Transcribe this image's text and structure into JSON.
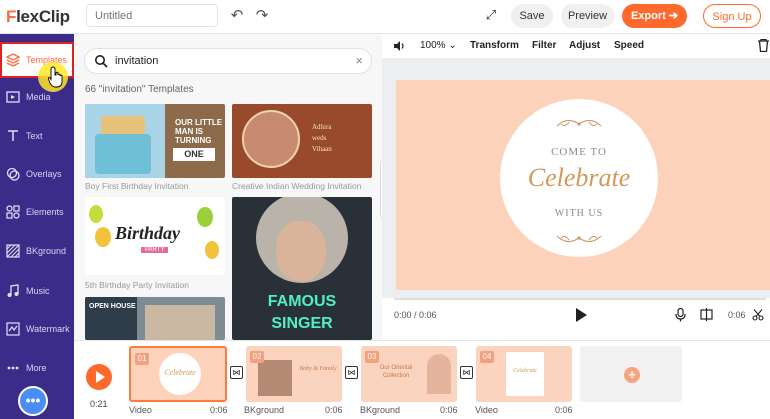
{
  "app": {
    "logo_f": "F",
    "logo_rest": "lexClip",
    "project_title_placeholder": "Untitled"
  },
  "topbar": {
    "save_label": "Save",
    "preview_label": "Preview",
    "export_label": "Export",
    "signup_label": "Sign Up"
  },
  "sidebar": {
    "items": [
      {
        "label": "Templates",
        "icon": "templates-icon"
      },
      {
        "label": "Media",
        "icon": "media-icon"
      },
      {
        "label": "Text",
        "icon": "text-icon"
      },
      {
        "label": "Overlays",
        "icon": "overlays-icon"
      },
      {
        "label": "Elements",
        "icon": "elements-icon"
      },
      {
        "label": "BKground",
        "icon": "background-icon"
      },
      {
        "label": "Music",
        "icon": "music-icon"
      },
      {
        "label": "Watermark",
        "icon": "watermark-icon"
      },
      {
        "label": "More",
        "icon": "more-icon"
      }
    ],
    "help_label": "•••"
  },
  "panel": {
    "search_value": "invitation",
    "result_count": "66 \"invitation\" Templates",
    "templates": [
      {
        "caption": "Boy First Birthday Invitation",
        "art_lines": [
          "OUR LITTLE",
          "MAN IS",
          "TURNING",
          "ONE"
        ]
      },
      {
        "caption": "Creative Indian Wedding Invitation",
        "art_lines": [
          "Adhira",
          "weds",
          "Vihaan"
        ]
      },
      {
        "caption": "5th Birthday Party Invitation",
        "art_lines": [
          "Birthday",
          "PARTY"
        ]
      },
      {
        "caption": "",
        "art_lines": [
          "FAMOUS",
          "SINGER"
        ]
      },
      {
        "caption": "",
        "art_lines": [
          "OPEN HOUSE"
        ]
      }
    ]
  },
  "toolbar": {
    "zoom": "100%",
    "transform": "Transform",
    "filter": "Filter",
    "adjust": "Adjust",
    "speed": "Speed"
  },
  "canvas": {
    "line1": "COME TO",
    "line2": "Celebrate",
    "line3": "WITH US",
    "bg_color": "#fdd2bb"
  },
  "player": {
    "current_time": "0:00 / 0:06",
    "duration": "0:06"
  },
  "timeline": {
    "total_duration": "0:21",
    "clips": [
      {
        "num": "01",
        "type": "Video",
        "length": "0:06"
      },
      {
        "num": "02",
        "type": "BKground",
        "length": "0:06"
      },
      {
        "num": "03",
        "type": "BKground",
        "length": "0:06"
      },
      {
        "num": "04",
        "type": "Video",
        "length": "0:06"
      }
    ],
    "clip_art": [
      "Celebrate",
      "Baby & Family",
      "Our Oriental Collection",
      "Celebrate"
    ]
  },
  "colors": {
    "accent": "#ff6a2c",
    "sidebar": "#3b2c8a",
    "canvas_peach": "#fdd2bb"
  }
}
